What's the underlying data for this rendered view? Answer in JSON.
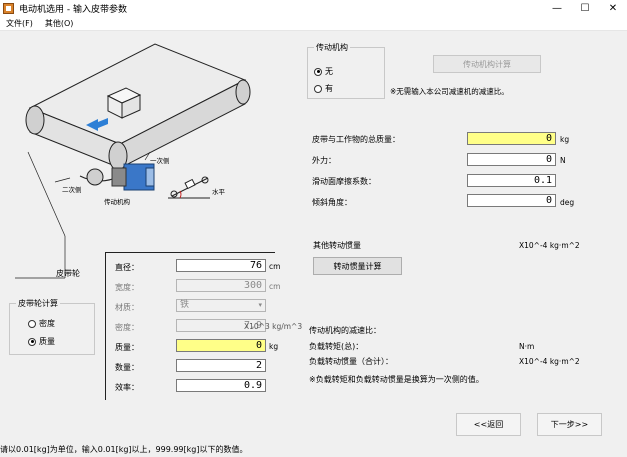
{
  "window": {
    "title": "电动机选用 - 输入皮带参数",
    "minimize": "—",
    "maximize": "☐",
    "close": "✕"
  },
  "menu": [
    "文件(F)",
    "其他(O)"
  ],
  "diagram": {
    "caption_first_stage": "一次侧",
    "caption_second_stage": "二次侧",
    "caption_mechanism": "传动机构",
    "caption_horizontal": "水平",
    "pulley_label": "皮带轮"
  },
  "pulley_calc": {
    "title": "皮带轮计算",
    "options": [
      {
        "label": "密度",
        "selected": false
      },
      {
        "label": "质量",
        "selected": true
      }
    ]
  },
  "pulley_params": [
    {
      "label": "直径：",
      "value": "76",
      "unit": "cm",
      "style": "normal"
    },
    {
      "label": "宽度：",
      "value": "300",
      "unit": "cm",
      "style": "disabled"
    },
    {
      "label": "材质：",
      "value": "铁",
      "unit": "",
      "style": "select-disabled"
    },
    {
      "label": "密度：",
      "value": "7.9",
      "unit": "X10^3 kg/m^3",
      "style": "disabled"
    },
    {
      "label": "质量：",
      "value": "0",
      "unit": "kg",
      "style": "yellow"
    },
    {
      "label": "数量：",
      "value": "2",
      "unit": "",
      "style": "normal"
    },
    {
      "label": "效率：",
      "value": "0.9",
      "unit": "",
      "style": "normal"
    }
  ],
  "mechanism": {
    "title": "传动机构",
    "options": [
      {
        "label": "无",
        "selected": true
      },
      {
        "label": "有",
        "selected": false
      }
    ],
    "calc_button": "传动机构计算",
    "note": "※无需输入本公司减速机的减速比。"
  },
  "main_params": [
    {
      "label": "皮带与工作物的总质量：",
      "value": "0",
      "unit": "kg",
      "style": "yellow"
    },
    {
      "label": "外力：",
      "value": "0",
      "unit": "N",
      "style": "normal"
    },
    {
      "label": "滑动面摩擦系数：",
      "value": "0.1",
      "unit": "",
      "style": "normal"
    },
    {
      "label": "倾斜角度：",
      "value": "0",
      "unit": "deg",
      "style": "normal"
    }
  ],
  "inertia": {
    "label": "其他转动惯量",
    "unit": "X10^-4 kg·m^2",
    "button": "转动惯量计算"
  },
  "mech_summary": {
    "title": "传动机构的减速比：",
    "torque_label": "负载转矩(总)：",
    "torque_unit": "N·m",
    "inertia_label": "负载转动惯量（合计）：",
    "inertia_unit": "X10^-4 kg·m^2",
    "note": "※负载转矩和负载转动惯量是换算为一次侧的值。"
  },
  "nav": {
    "back": "<<返回",
    "next": "下一步>>"
  },
  "status": "请以0.01[kg]为单位，输入0.01[kg]以上，999.99[kg]以下的数值。"
}
